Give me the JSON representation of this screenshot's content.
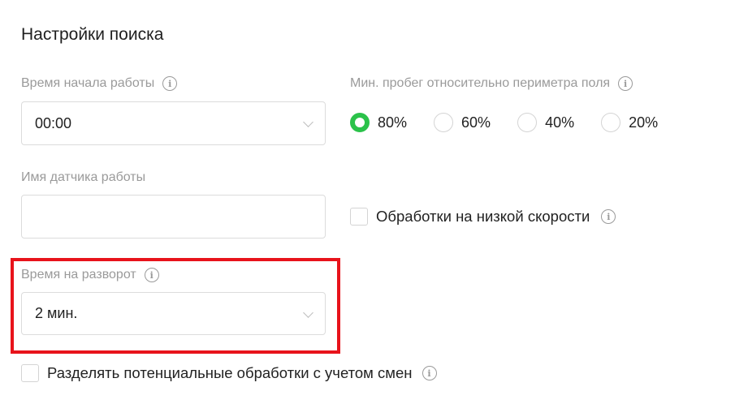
{
  "section": {
    "title": "Настройки поиска"
  },
  "start_time": {
    "label": "Время начала работы",
    "value": "00:00"
  },
  "sensor_name": {
    "label": "Имя датчика работы",
    "value": ""
  },
  "turn_time": {
    "label": "Время на разворот",
    "value": "2 мин."
  },
  "min_mileage": {
    "label": "Мин. пробег относительно периметра поля",
    "options": [
      "80%",
      "60%",
      "40%",
      "20%"
    ],
    "selected": "80%"
  },
  "low_speed": {
    "label": "Обработки на низкой скорости",
    "checked": false
  },
  "split_by_shifts": {
    "label": "Разделять потенциальные обработки с учетом смен",
    "checked": false
  },
  "colors": {
    "accent": "#2bc24a",
    "highlight": "#e8131b"
  }
}
